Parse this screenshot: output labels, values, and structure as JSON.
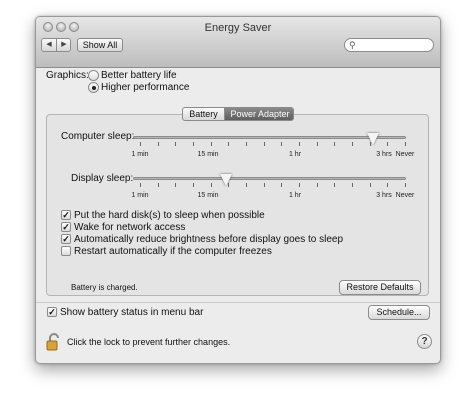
{
  "window": {
    "title": "Energy Saver"
  },
  "toolbar": {
    "back_glyph": "◀",
    "forward_glyph": "▶",
    "show_all_label": "Show All",
    "search_icon": "magnifier-icon",
    "search_placeholder": ""
  },
  "graphics": {
    "label": "Graphics:",
    "options": [
      {
        "label": "Better battery life",
        "selected": false
      },
      {
        "label": "Higher performance",
        "selected": true
      }
    ]
  },
  "tabs": [
    {
      "label": "Battery",
      "selected": false
    },
    {
      "label": "Power Adapter",
      "selected": true
    }
  ],
  "sliders": [
    {
      "label": "Computer sleep:",
      "value_fraction": 0.88
    },
    {
      "label": "Display sleep:",
      "value_fraction": 0.34
    }
  ],
  "tick_labels": [
    "1 min",
    "15 min",
    "1 hr",
    "3 hrs",
    "Never"
  ],
  "checkboxes": [
    {
      "label": "Put the hard disk(s) to sleep when possible",
      "checked": true
    },
    {
      "label": "Wake for network access",
      "checked": true
    },
    {
      "label": "Automatically reduce brightness before display goes to sleep",
      "checked": true
    },
    {
      "label": "Restart automatically if the computer freezes",
      "checked": false
    }
  ],
  "status_text": "Battery is charged.",
  "restore_defaults_label": "Restore Defaults",
  "show_battery_status": {
    "label": "Show battery status in menu bar",
    "checked": true
  },
  "schedule_label": "Schedule...",
  "lock_text": "Click the lock to prevent further changes.",
  "help_glyph": "?",
  "colors": {
    "window_bg": "#ececec",
    "accent_tab": "#6e6e6e"
  }
}
